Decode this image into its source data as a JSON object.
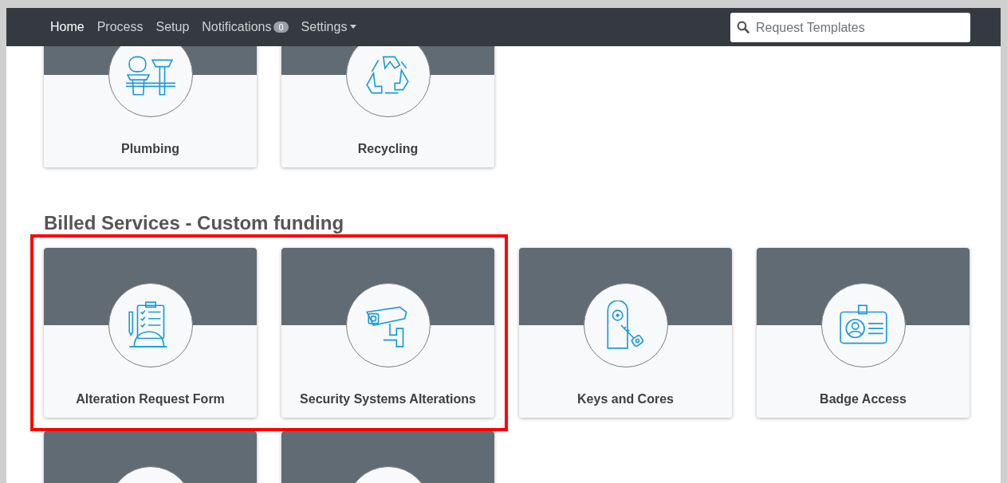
{
  "navbar": {
    "items": [
      {
        "label": "Home",
        "selected": true
      },
      {
        "label": "Process",
        "selected": false
      },
      {
        "label": "Setup",
        "selected": false
      },
      {
        "label": "Notifications",
        "selected": false,
        "badge": "0"
      },
      {
        "label": "Settings",
        "selected": false,
        "dropdown": true
      }
    ],
    "search": {
      "placeholder": "Request Templates"
    }
  },
  "sections": [
    {
      "cards": [
        {
          "label": "Plumbing",
          "highlighted": false
        },
        {
          "label": "Recycling",
          "highlighted": false
        }
      ]
    },
    {
      "title": "Billed Services - Custom funding",
      "cards": [
        {
          "label": "Alteration Request Form",
          "highlighted": true
        },
        {
          "label": "Security Systems Alterations",
          "highlighted": true
        },
        {
          "label": "Keys and Cores",
          "highlighted": false
        },
        {
          "label": "Badge Access",
          "highlighted": false
        },
        {
          "highlighted": false
        },
        {
          "highlighted": false
        }
      ]
    }
  ]
}
